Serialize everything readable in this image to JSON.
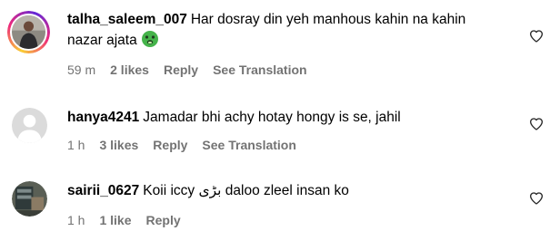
{
  "comments": [
    {
      "username": "talha_saleem_007",
      "text_line1": "Har dosray din yeh manhous kahin na kahin",
      "text_line2": "nazar ajata",
      "emoji_icon": "nauseated-face-icon",
      "time": "59 m",
      "likes": "2 likes",
      "reply": "Reply",
      "translate": "See Translation",
      "avatar_style": "story-ring"
    },
    {
      "username": "hanya4241",
      "text": "Jamadar bhi achy hotay hongy is se, jahil",
      "time": "1 h",
      "likes": "3 likes",
      "reply": "Reply",
      "translate": "See Translation",
      "avatar_style": "default-placeholder"
    },
    {
      "username": "sairii_0627",
      "text": "Koii iccy بڑی daloo zleel insan ko",
      "time": "1 h",
      "likes": "1 like",
      "reply": "Reply",
      "avatar_style": "photo"
    }
  ],
  "colors": {
    "meta_text": "#737373",
    "default_avatar_bg": "#dbdbdb",
    "emoji_green": "#45b34a"
  },
  "icons": {
    "like": "heart-outline-icon"
  }
}
